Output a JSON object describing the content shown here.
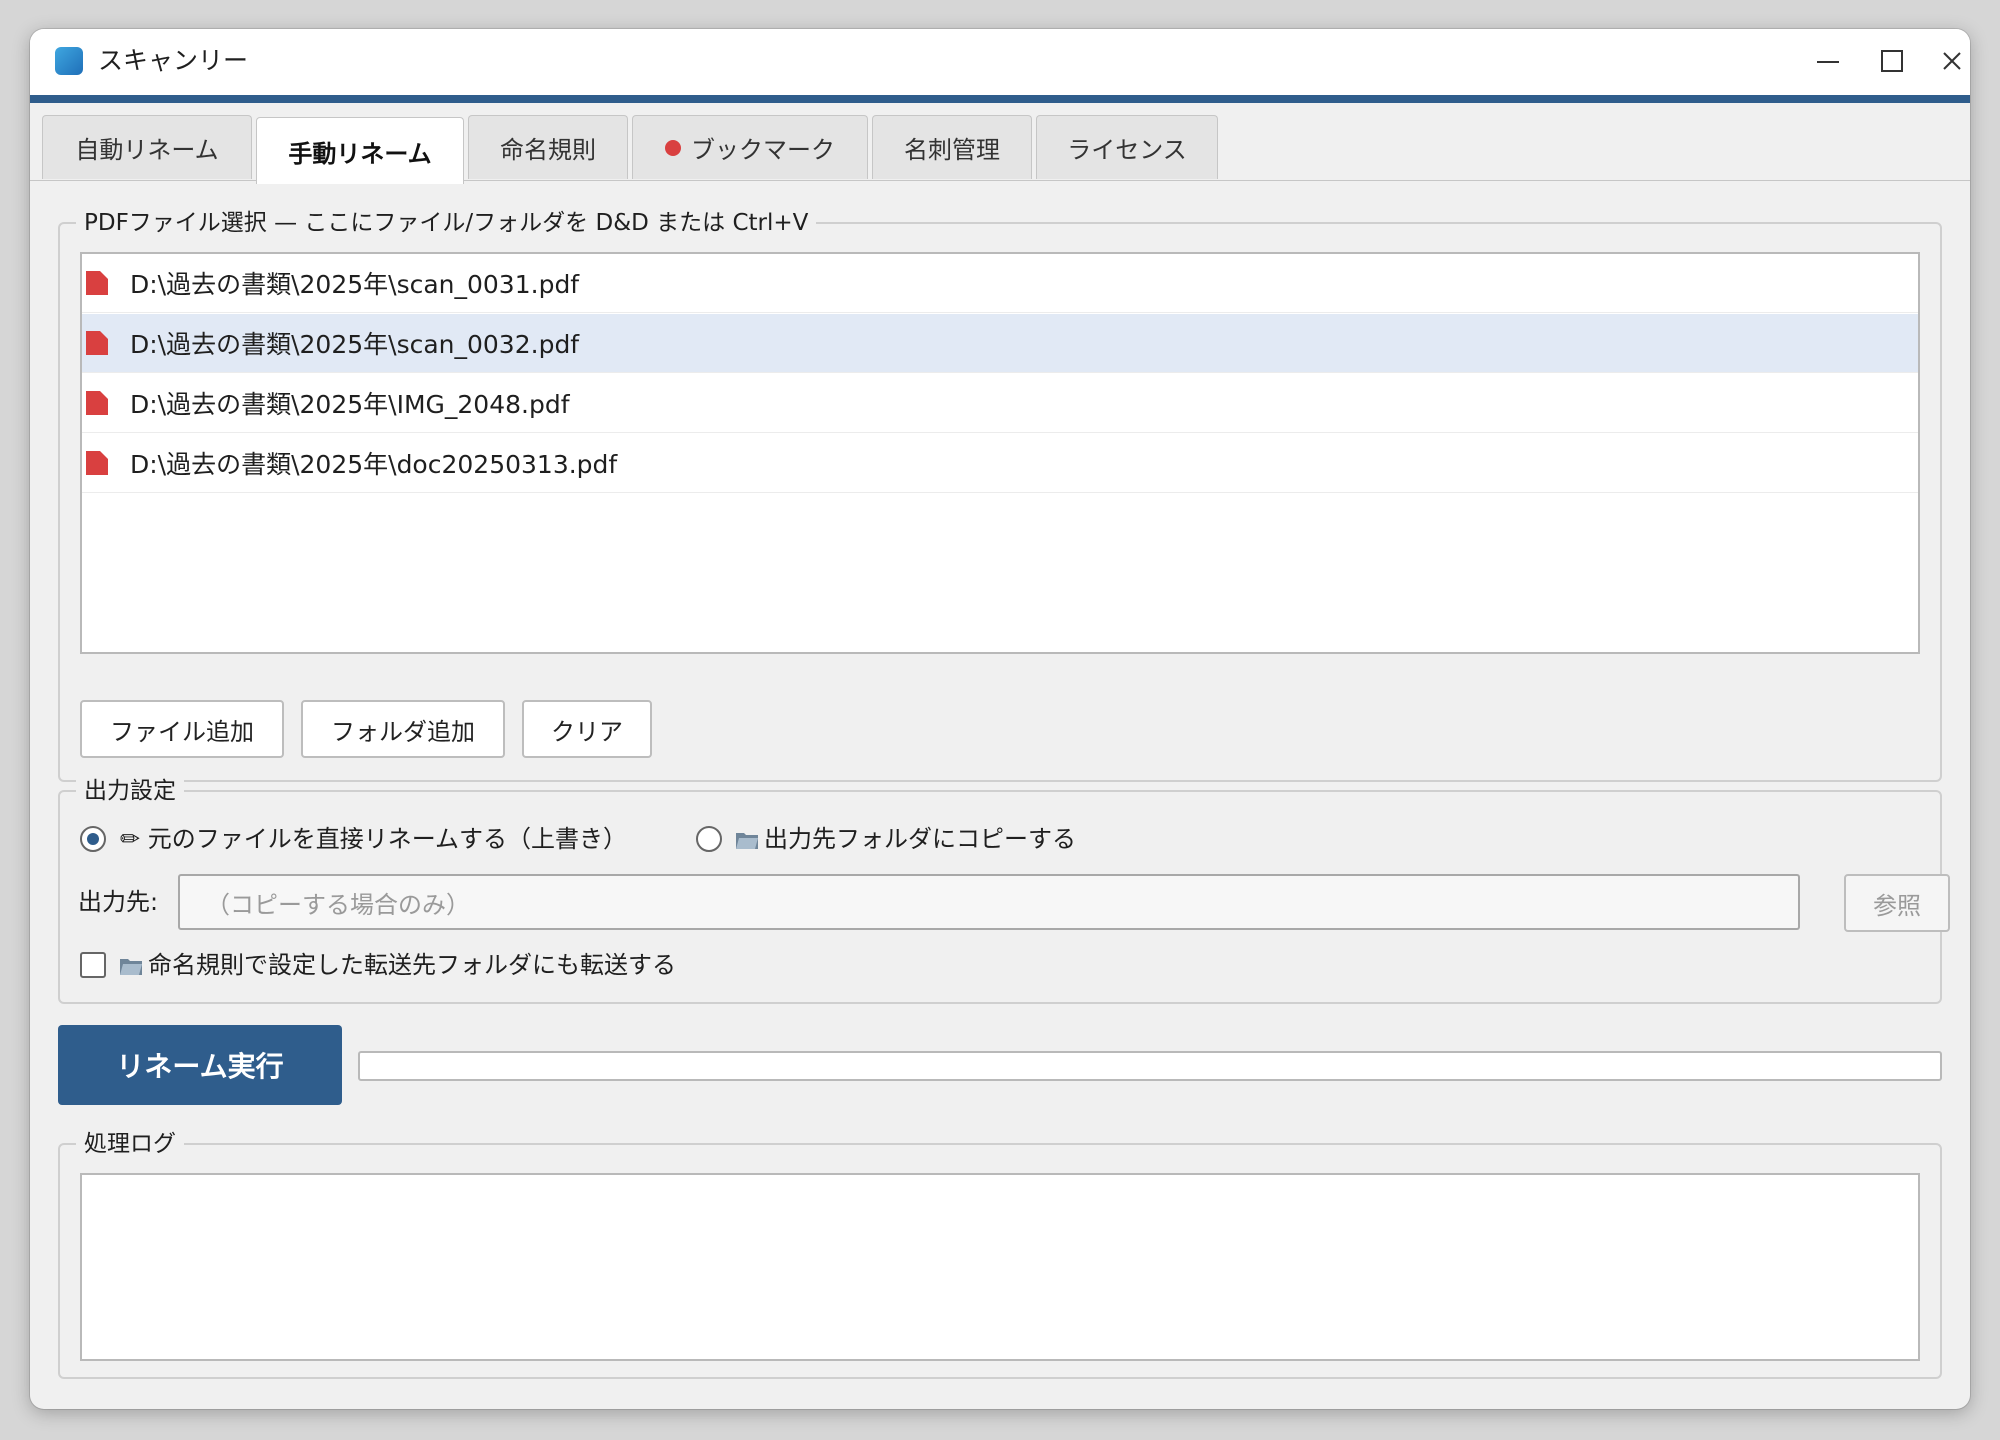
{
  "window": {
    "title": "スキャンリー"
  },
  "tabs": [
    {
      "label": "自動リネーム",
      "active": false
    },
    {
      "label": "手動リネーム",
      "active": true
    },
    {
      "label": "命名規則",
      "active": false
    },
    {
      "label": "ブックマーク",
      "active": false,
      "dot": true
    },
    {
      "label": "名刺管理",
      "active": false
    },
    {
      "label": "ライセンス",
      "active": false
    }
  ],
  "file_select": {
    "legend": "PDFファイル選択 — ここにファイル/フォルダを D&D または Ctrl+V",
    "files": [
      {
        "path": "D:\\過去の書類\\2025年\\scan_0031.pdf",
        "selected": false
      },
      {
        "path": "D:\\過去の書類\\2025年\\scan_0032.pdf",
        "selected": true
      },
      {
        "path": "D:\\過去の書類\\2025年\\IMG_2048.pdf",
        "selected": false
      },
      {
        "path": "D:\\過去の書類\\2025年\\doc20250313.pdf",
        "selected": false
      }
    ],
    "add_file_label": "ファイル追加",
    "add_folder_label": "フォルダ追加",
    "clear_label": "クリア"
  },
  "output": {
    "legend": "出力設定",
    "option_rename": "✏ 元のファイルを直接リネームする（上書き）",
    "option_copy": "出力先フォルダにコピーする",
    "selected_option": "rename",
    "dest_label": "出力先:",
    "dest_value": "",
    "dest_placeholder": "（コピーする場合のみ）",
    "browse_label": "参照",
    "transfer_label": "命名規則で設定した転送先フォルダにも転送する",
    "transfer_checked": false
  },
  "run": {
    "label": "リネーム実行",
    "progress": 0
  },
  "log": {
    "legend": "処理ログ",
    "content": ""
  },
  "colors": {
    "accent": "#2f5d8c",
    "selected_row": "#e1e9f5",
    "pdf_icon": "#d94040",
    "tab_dot": "#d94040"
  }
}
